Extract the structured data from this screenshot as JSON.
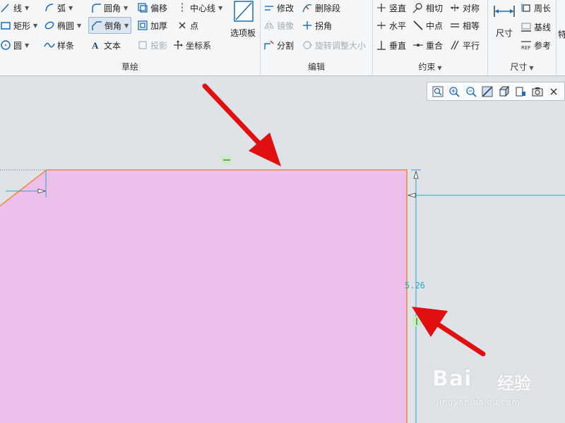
{
  "ribbon": {
    "sketch_group": {
      "label": "草绘",
      "tools": {
        "line": "线",
        "arc": "弧",
        "fillet": "圆角",
        "offset": "偏移",
        "centerline": "中心线",
        "rectangle": "矩形",
        "ellipse": "椭圆",
        "chamfer": "倒角",
        "thicken": "加厚",
        "point": "点",
        "circle": "圆",
        "spline": "样条",
        "text": "文本",
        "project": "投影",
        "coord_system": "坐标系",
        "palette": "选项板"
      }
    },
    "edit_group": {
      "label": "编辑",
      "tools": {
        "modify": "修改",
        "delete_segment": "删除段",
        "mirror": "镜像",
        "corner": "拐角",
        "divide": "分割",
        "rotate_resize": "旋转调整大小"
      }
    },
    "constrain_group": {
      "label": "约束",
      "tools": {
        "vertical": "竖直",
        "tangent": "相切",
        "symmetric": "对称",
        "horizontal": "水平",
        "midpoint": "中点",
        "equal": "相等",
        "perpendicular": "垂直",
        "coincident": "重合",
        "parallel": "平行"
      }
    },
    "dimension_group": {
      "label": "尺寸",
      "tools": {
        "dimension": "尺寸",
        "perimeter": "周长",
        "baseline": "基线",
        "reference": "参考"
      }
    }
  },
  "sketch": {
    "dimension_value": "5.26",
    "fill_color": "#ecc0ea",
    "edge_color": "#f08a3c",
    "dim_color": "#2aa6c4"
  },
  "view_toolbar": {
    "icons": [
      "zoom-fit-icon",
      "zoom-in-icon",
      "zoom-out-icon",
      "repaint-icon",
      "display-style-icon",
      "saved-views-icon",
      "sketch-view-icon",
      "close-icon"
    ]
  },
  "watermark": {
    "brand": "Bai",
    "brand_cn": "经验",
    "url": "jingyan.baidu.com"
  },
  "colors": {
    "accent": "#2aa6c4",
    "arrow": "#e01010"
  }
}
